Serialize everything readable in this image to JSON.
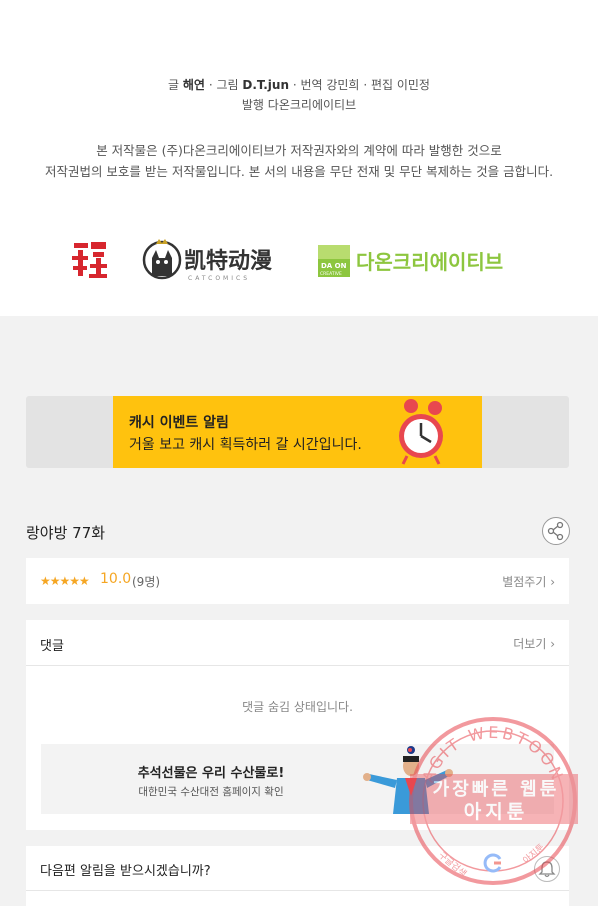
{
  "credits": {
    "writer_label": "글",
    "writer": "해연",
    "artist_label": "· 그림",
    "artist": "D.T.jun",
    "translator": "· 번역 강민희",
    "editor": "· 편집 이민정",
    "publisher": "발행 다온크리에이티브"
  },
  "notice": {
    "line1": "본 저작물은 (주)다온크리에이티브가 저작권자와의 계약에 따라 발행한 것으로",
    "line2": "저작권법의 보호를 받는 저작물입니다. 본 서의 내용을 무단 전재 및 무단 복제하는 것을 금합니다."
  },
  "logos": {
    "cat_text": "凯特动漫",
    "cat_sub": "CATCOMICS",
    "daon_badge_top": "DA ON",
    "daon_badge_bottom": "CREATIVE",
    "daon_text": "다온크리에이티브"
  },
  "banner": {
    "title": "캐시 이벤트 알림",
    "subtitle": "거울 보고 캐시 획득하러 갈 시간입니다."
  },
  "episode": {
    "title": "랑야방 77화"
  },
  "rating": {
    "stars": "★★★★★",
    "score": "10.0",
    "voters": "(9명)",
    "rate_link": "별점주기 ›"
  },
  "comments": {
    "title": "댓글",
    "more": "더보기 ›",
    "hidden_text": "댓글 숨김 상태입니다."
  },
  "ad": {
    "title": "추석선물은 우리 수산물로!",
    "subtitle": "대한민국 수산대전 홈페이지 확인"
  },
  "next_alert": {
    "title": "다음편 알림을 받으시겠습니까?"
  },
  "watermark": {
    "arc_text": "AGIT WEBTOON",
    "line1": "가장빠른 웹툰",
    "line2": "아지툰",
    "left_small": "구글검색",
    "right_small": "아지툰"
  },
  "colors": {
    "banner_yellow": "#ffc20e",
    "star_orange": "#f5a623",
    "daon_green": "#8dc63f",
    "watermark_red": "#e8474f"
  }
}
